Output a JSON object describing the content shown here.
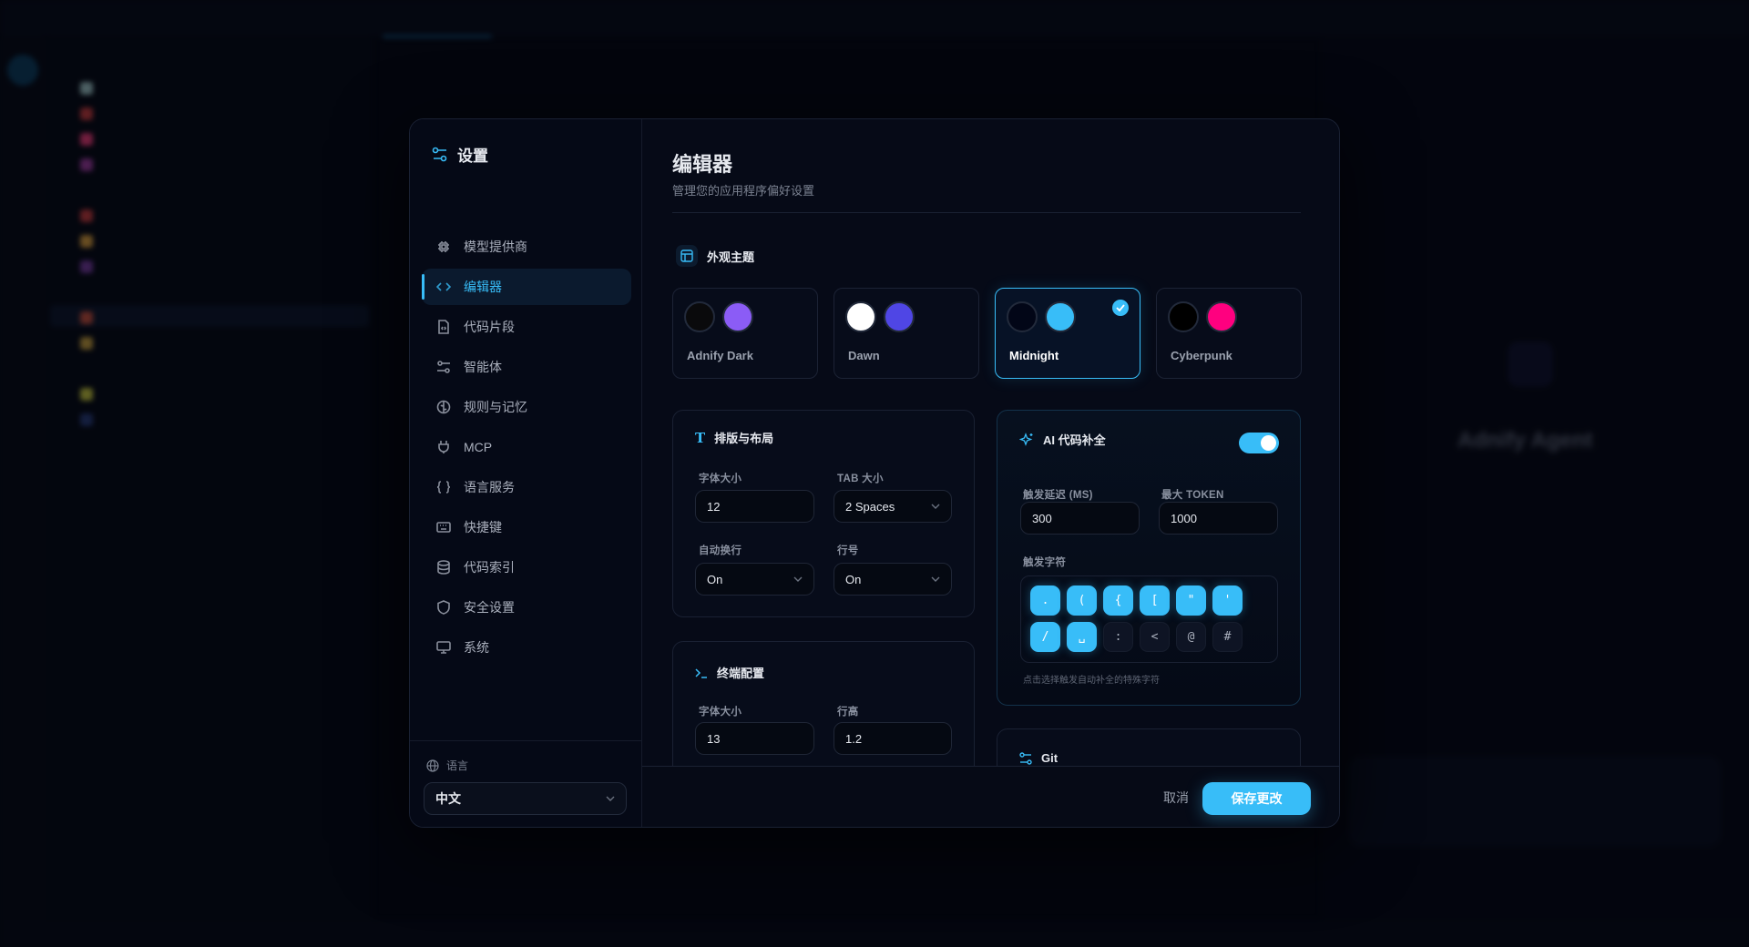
{
  "background": {
    "agent_title": "Adnify Agent"
  },
  "sidebar": {
    "title": "设置",
    "items": [
      {
        "label": "模型提供商",
        "icon": "cpu-icon"
      },
      {
        "label": "编辑器",
        "icon": "code-icon",
        "active": true
      },
      {
        "label": "代码片段",
        "icon": "file-code-icon"
      },
      {
        "label": "智能体",
        "icon": "sliders-icon"
      },
      {
        "label": "规则与记忆",
        "icon": "brain-icon"
      },
      {
        "label": "MCP",
        "icon": "plug-icon"
      },
      {
        "label": "语言服务",
        "icon": "braces-icon"
      },
      {
        "label": "快捷键",
        "icon": "keyboard-icon"
      },
      {
        "label": "代码索引",
        "icon": "database-icon"
      },
      {
        "label": "安全设置",
        "icon": "shield-icon"
      },
      {
        "label": "系统",
        "icon": "monitor-icon"
      }
    ],
    "language": {
      "label": "语言",
      "value": "中文"
    }
  },
  "main": {
    "title": "编辑器",
    "subtitle": "管理您的应用程序偏好设置",
    "appearance": {
      "title": "外观主题",
      "themes": [
        {
          "name": "Adnify Dark",
          "colors": [
            "#0a0a0c",
            "#8b5cf6"
          ]
        },
        {
          "name": "Dawn",
          "colors": [
            "#ffffff",
            "#4f46e5"
          ]
        },
        {
          "name": "Midnight",
          "colors": [
            "#020617",
            "#38bdf8"
          ],
          "selected": true
        },
        {
          "name": "Cyberpunk",
          "colors": [
            "#000000",
            "#ff007f"
          ]
        }
      ]
    },
    "typography": {
      "title": "排版与布局",
      "font_size_label": "字体大小",
      "font_size": "12",
      "tab_size_label": "TAB 大小",
      "tab_size": "2 Spaces",
      "word_wrap_label": "自动换行",
      "word_wrap": "On",
      "line_numbers_label": "行号",
      "line_numbers": "On"
    },
    "terminal": {
      "title": "终端配置",
      "font_size_label": "字体大小",
      "font_size": "13",
      "line_height_label": "行高",
      "line_height": "1.2"
    },
    "ai_completion": {
      "title": "AI 代码补全",
      "enabled": true,
      "delay_label": "触发延迟 (MS)",
      "delay": "300",
      "max_token_label": "最大 TOKEN",
      "max_token": "1000",
      "trigger_label": "触发字符",
      "triggers": [
        {
          "char": ".",
          "on": true
        },
        {
          "char": "(",
          "on": true
        },
        {
          "char": "{",
          "on": true
        },
        {
          "char": "[",
          "on": true
        },
        {
          "char": "\"",
          "on": true
        },
        {
          "char": "'",
          "on": true
        },
        {
          "char": "/",
          "on": true
        },
        {
          "char": "␣",
          "on": true
        },
        {
          "char": ":",
          "on": false
        },
        {
          "char": "<",
          "on": false
        },
        {
          "char": "@",
          "on": false
        },
        {
          "char": "#",
          "on": false
        }
      ],
      "hint": "点击选择触发自动补全的特殊字符"
    },
    "git": {
      "title": "Git"
    }
  },
  "footer": {
    "cancel": "取消",
    "save": "保存更改"
  },
  "colors": {
    "accent": "#38bdf8",
    "background": "#03050d",
    "panel": "#060a17"
  }
}
